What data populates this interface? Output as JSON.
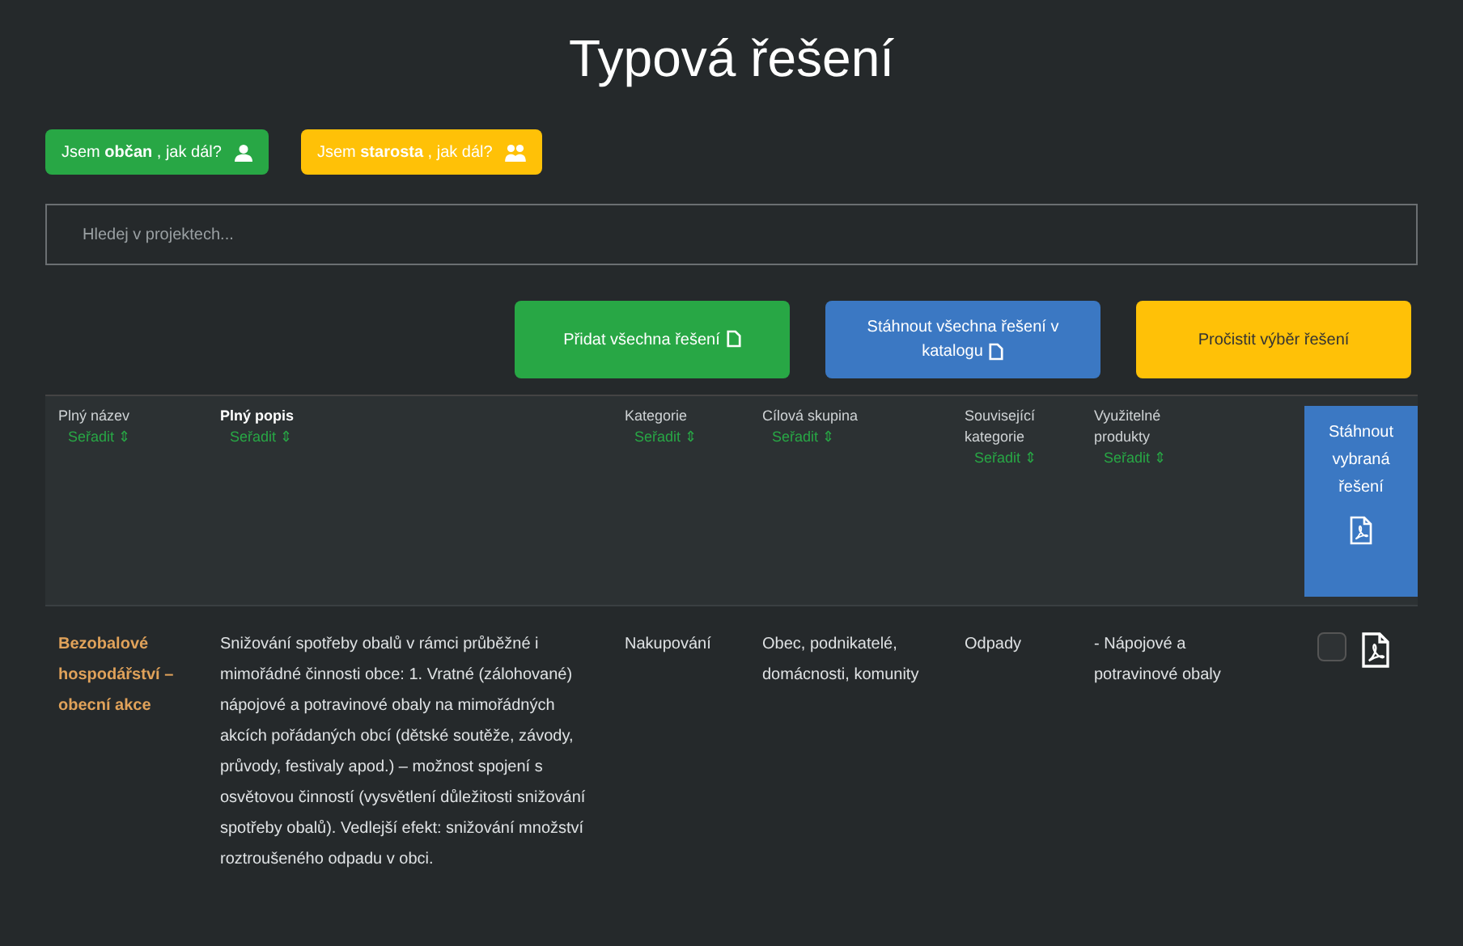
{
  "title": "Typová řešení",
  "role_buttons": [
    {
      "label": "Jsem **občan** , jak dál?",
      "kind": "citizen"
    },
    {
      "label": "Jsem **starosta** , jak dál?",
      "kind": "mayor"
    }
  ],
  "search": {
    "placeholder": "Hledej v projektech..."
  },
  "actions": [
    {
      "label": "Přidat všechna řešení",
      "kind": "green",
      "icon": true
    },
    {
      "label": "Stáhnout všechna řešení v katalogu",
      "kind": "blue",
      "icon": true
    },
    {
      "label": "Pročistit výběr řešení",
      "kind": "yellow",
      "icon": false
    }
  ],
  "table": {
    "columns": [
      {
        "label": "Plný název",
        "sort": "Seřadit ⇕",
        "active": false
      },
      {
        "label": "Plný popis",
        "sort": "Seřadit ⇕",
        "active": true
      },
      {
        "label": "Kategorie",
        "sort": "Seřadit ⇕",
        "active": false
      },
      {
        "label": "Cílová skupina",
        "sort": "Seřadit ⇕",
        "active": false
      },
      {
        "label": "Související kategorie",
        "sort": "Seřadit ⇕",
        "active": false
      },
      {
        "label": "Využitelné produkty",
        "sort": "Seřadit ⇕",
        "active": false
      }
    ],
    "download_selected": "Stáhnout vybraná řešení",
    "rows": [
      {
        "name": "Bezobalové hospodářství – obecní akce",
        "description": "Snižování spotřeby obalů v rámci průběžné i mimořádné činnosti obce: 1. Vratné (zálohované) nápojové a potravinové obaly na mimořádných akcích pořádaných obcí (dětské soutěže, závody, průvody, festivaly apod.) – možnost spojení s osvětovou činností (vysvětlení důležitosti snižování spotřeby obalů). Vedlejší efekt: snižování množství roztroušeného odpadu v obci.",
        "category": "Nakupování",
        "target": "Obec, podnikatelé, domácnosti, komunity",
        "related": "Odpady",
        "products": "- Nápojové a potravinové obaly",
        "checked": false
      }
    ]
  }
}
